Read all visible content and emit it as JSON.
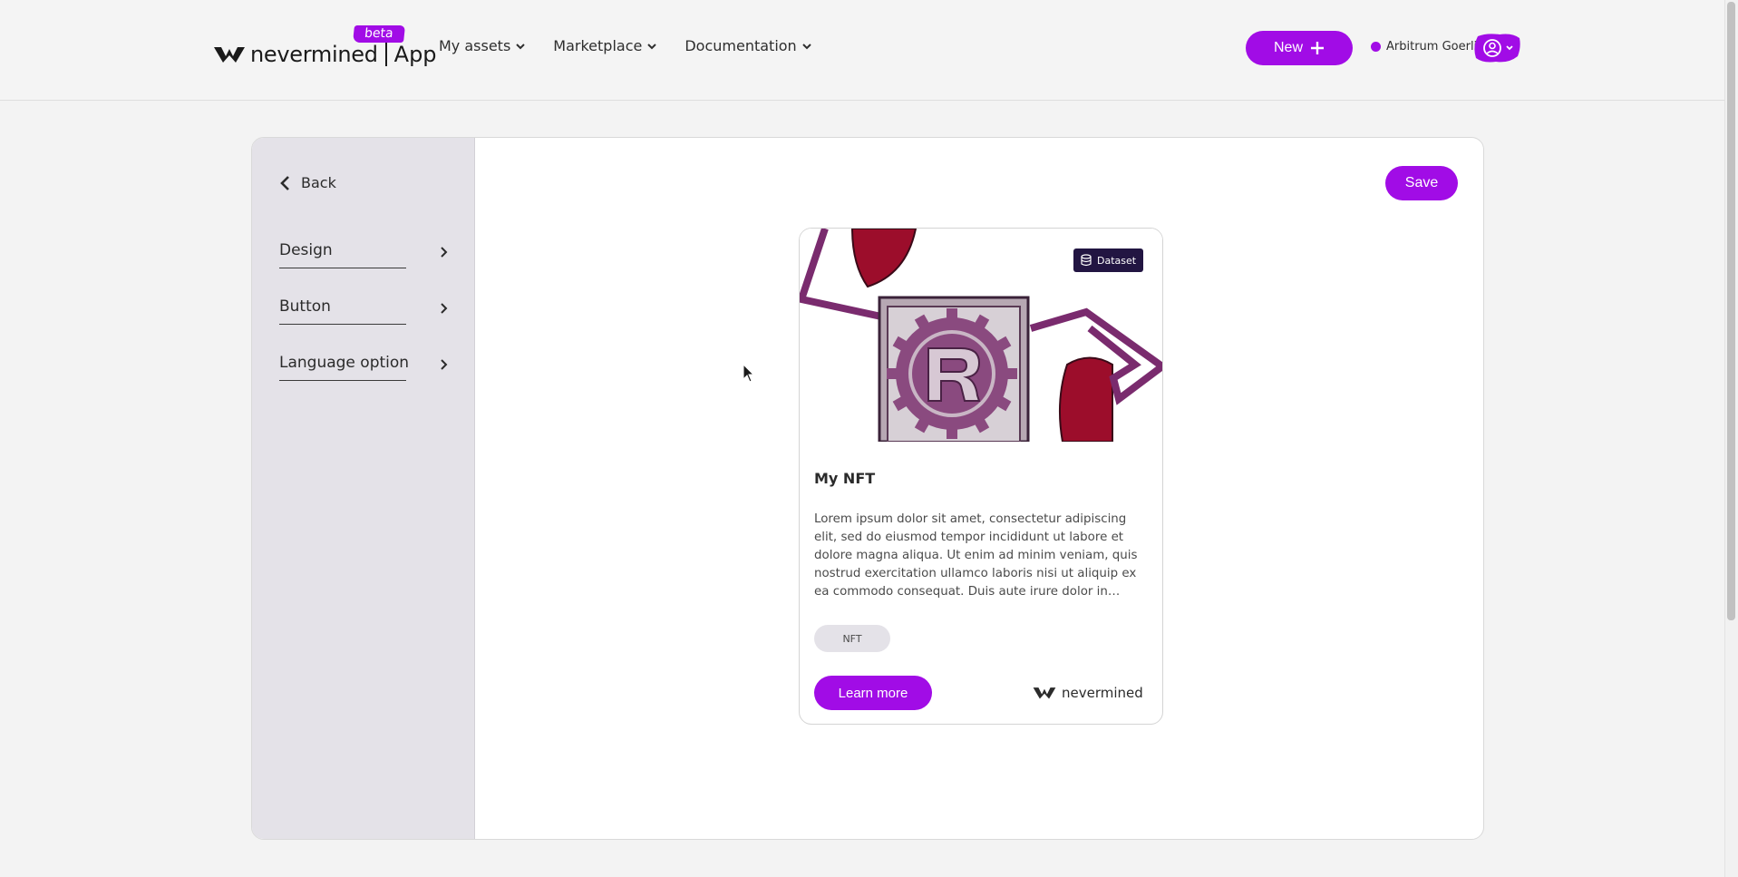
{
  "header": {
    "brand": "nevermined",
    "app": "App",
    "beta": "beta",
    "nav": [
      {
        "label": "My assets"
      },
      {
        "label": "Marketplace"
      },
      {
        "label": "Documentation"
      }
    ],
    "new_button": "New",
    "network": "Arbitrum Goerli"
  },
  "sidebar": {
    "back": "Back",
    "items": [
      {
        "label": "Design"
      },
      {
        "label": "Button"
      },
      {
        "label": "Language option"
      }
    ]
  },
  "toolbar": {
    "save": "Save"
  },
  "card": {
    "badge": "Dataset",
    "title": "My NFT",
    "description": "Lorem ipsum dolor sit amet, consectetur adipiscing elit, sed do eiusmod tempor incididunt ut labore et dolore magna aliqua. Ut enim ad minim veniam, quis nostrud exercitation ullamco laboris nisi ut aliquip ex ea commodo consequat. Duis aute irure dolor in…",
    "tag": "NFT",
    "cta": "Learn more",
    "brand": "nevermined"
  },
  "colors": {
    "accent": "#a10ce6",
    "badge_bg": "#221542",
    "sidebar_bg": "#e4e2e8",
    "image_red": "#9c0d2b",
    "image_purple": "#7a2b6e"
  },
  "icons": [
    "nevermined-logo-icon",
    "chevron-down-icon",
    "plus-icon",
    "user-circle-icon",
    "chevron-left-icon",
    "chevron-right-icon",
    "database-icon",
    "rust-logo-icon"
  ]
}
